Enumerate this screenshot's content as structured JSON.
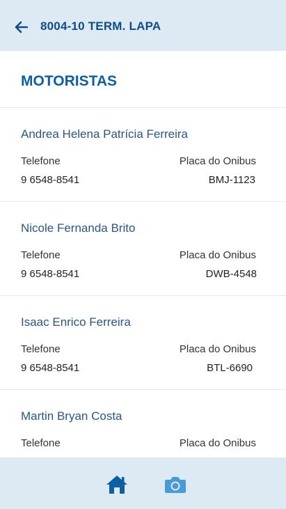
{
  "header": {
    "title": "8004-10 TERM. LAPA",
    "back_icon": "arrow-left-icon"
  },
  "section": {
    "title": "MOTORISTAS"
  },
  "drivers": [
    {
      "name": "Andrea Helena Patrícia Ferreira",
      "phone_label": "Telefone",
      "phone": "9 6548-8541",
      "plate_label": "Placa do Onibus",
      "plate": "BMJ-1123"
    },
    {
      "name": "Nicole Fernanda Brito",
      "phone_label": "Telefone",
      "phone": "9 6548-8541",
      "plate_label": "Placa do Onibus",
      "plate": "DWB-4548"
    },
    {
      "name": "Isaac Enrico Ferreira",
      "phone_label": "Telefone",
      "phone": "9 6548-8541",
      "plate_label": "Placa do Onibus",
      "plate": "BTL-6690"
    },
    {
      "name": "Martin Bryan Costa",
      "phone_label": "Telefone",
      "phone": "",
      "plate_label": "Placa do Onibus",
      "plate": ""
    }
  ],
  "bottom_nav": {
    "home_icon": "home-icon",
    "camera_icon": "camera-icon",
    "home_color": "#0d5fa3",
    "camera_color": "#4a9ad8"
  },
  "colors": {
    "bar_background": "#dde9f3",
    "title_blue": "#0d5fa3",
    "name_blue": "#2a5585"
  }
}
